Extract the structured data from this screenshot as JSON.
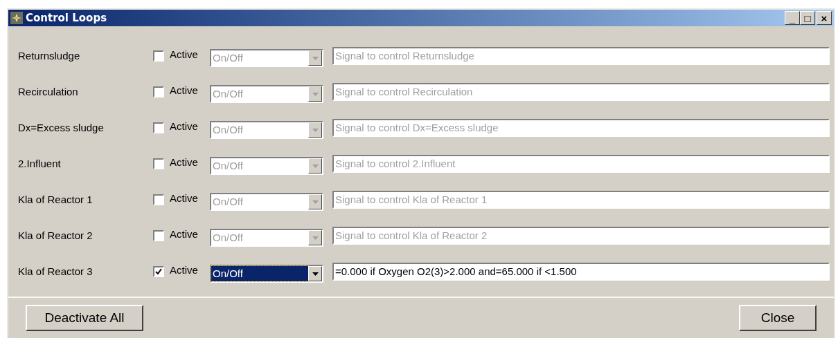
{
  "window": {
    "title": "Control Loops",
    "controls": [
      "_",
      "□",
      "×"
    ]
  },
  "loops": [
    {
      "name": "Returnsludge",
      "active": false,
      "active_label": "Active",
      "mode": "On/Off",
      "focused": false,
      "signal": "Signal to control Returnsludge"
    },
    {
      "name": "Recirculation",
      "active": false,
      "active_label": "Active",
      "mode": "On/Off",
      "focused": false,
      "signal": "Signal to control Recirculation"
    },
    {
      "name": "Dx=Excess sludge",
      "active": false,
      "active_label": "Active",
      "mode": "On/Off",
      "focused": false,
      "signal": "Signal to control Dx=Excess sludge"
    },
    {
      "name": "2.Influent",
      "active": false,
      "active_label": "Active",
      "mode": "On/Off",
      "focused": false,
      "signal": "Signal to control 2.Influent"
    },
    {
      "name": "Kla of Reactor 1",
      "active": false,
      "active_label": "Active",
      "mode": "On/Off",
      "focused": false,
      "signal": "Signal to control Kla of Reactor 1"
    },
    {
      "name": "Kla of Reactor 2",
      "active": false,
      "active_label": "Active",
      "mode": "On/Off",
      "focused": false,
      "signal": "Signal to control Kla of Reactor 2"
    },
    {
      "name": "Kla of Reactor 3",
      "active": true,
      "active_label": "Active",
      "mode": "On/Off",
      "focused": true,
      "signal": "=0.000 if Oxygen O2(3)>2.000 and=65.000 if <1.500"
    }
  ],
  "buttons": [
    "Deactivate All",
    "Close"
  ]
}
